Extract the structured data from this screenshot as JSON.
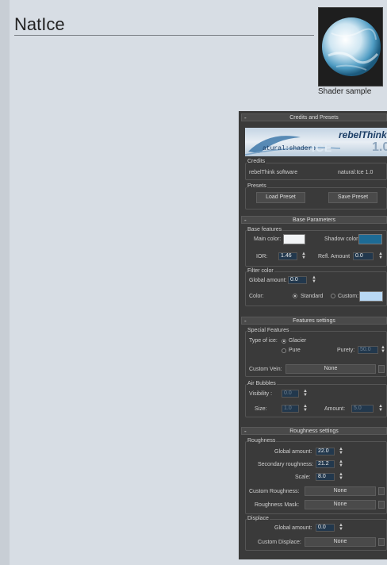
{
  "page": {
    "title": "NatIce"
  },
  "sample": {
    "caption": "Shader sample"
  },
  "credits_presets": {
    "header": "Credits and Presets",
    "banner_brand": "rebelThink",
    "banner_version": "1.0",
    "banner_natural": "atural:shaders",
    "banner_product": "ICE",
    "credits_label": "Credits",
    "credit_left": "rebelThink software",
    "credit_right": "natural:Ice 1.0",
    "presets_label": "Presets",
    "load_preset": "Load Preset",
    "save_preset": "Save Preset"
  },
  "base_parameters": {
    "header": "Base Parameters",
    "base_features_label": "Base features",
    "main_color_label": "Main color:",
    "shadow_color_label": "Shadow color:",
    "ior_label": "IOR:",
    "ior_value": "1.46",
    "refl_amount_label": "Refl. Amount",
    "refl_amount_value": "0.0",
    "filter_color_label": "Filter color",
    "global_amount_label": "Global amount:",
    "global_amount_value": "0.0",
    "color_label": "Color:",
    "standard_label": "Standard",
    "custom_label": "Custom:",
    "colors": {
      "main": "#f2f4f6",
      "shadow": "#1d6b95",
      "custom": "#b8d8f4"
    }
  },
  "features_settings": {
    "header": "Features settings",
    "special_features_label": "Special Features",
    "type_of_ice_label": "Type of ice:",
    "glacier_label": "Glacier",
    "pure_label": "Pure",
    "purety_label": "Purety:",
    "purety_value": "50.0",
    "custom_vein_label": "Custom Vein:",
    "custom_vein_button": "None",
    "air_bubbles_label": "Air Bubbles",
    "visibility_label": "Visibility :",
    "visibility_value": "0.0",
    "size_label": "Size:",
    "size_value": "1.0",
    "amount_label": "Amount:",
    "amount_value": "5.0"
  },
  "roughness_settings": {
    "header": "Roughness settings",
    "roughness_label": "Roughness",
    "global_amount_label": "Global amount:",
    "global_amount_value": "22.0",
    "secondary_roughness_label": "Secondary roughness:",
    "secondary_roughness_value": "21.2",
    "scale_label": "Scale:",
    "scale_value": "8.0",
    "custom_roughness_label": "Custom Roughness:",
    "custom_roughness_button": "None",
    "roughness_mask_label": "Roughness Mask:",
    "roughness_mask_button": "None",
    "displace_label": "Displace",
    "displace_global_label": "Global amount:",
    "displace_global_value": "0.0",
    "custom_displace_label": "Custom Displace:",
    "custom_displace_button": "None"
  }
}
